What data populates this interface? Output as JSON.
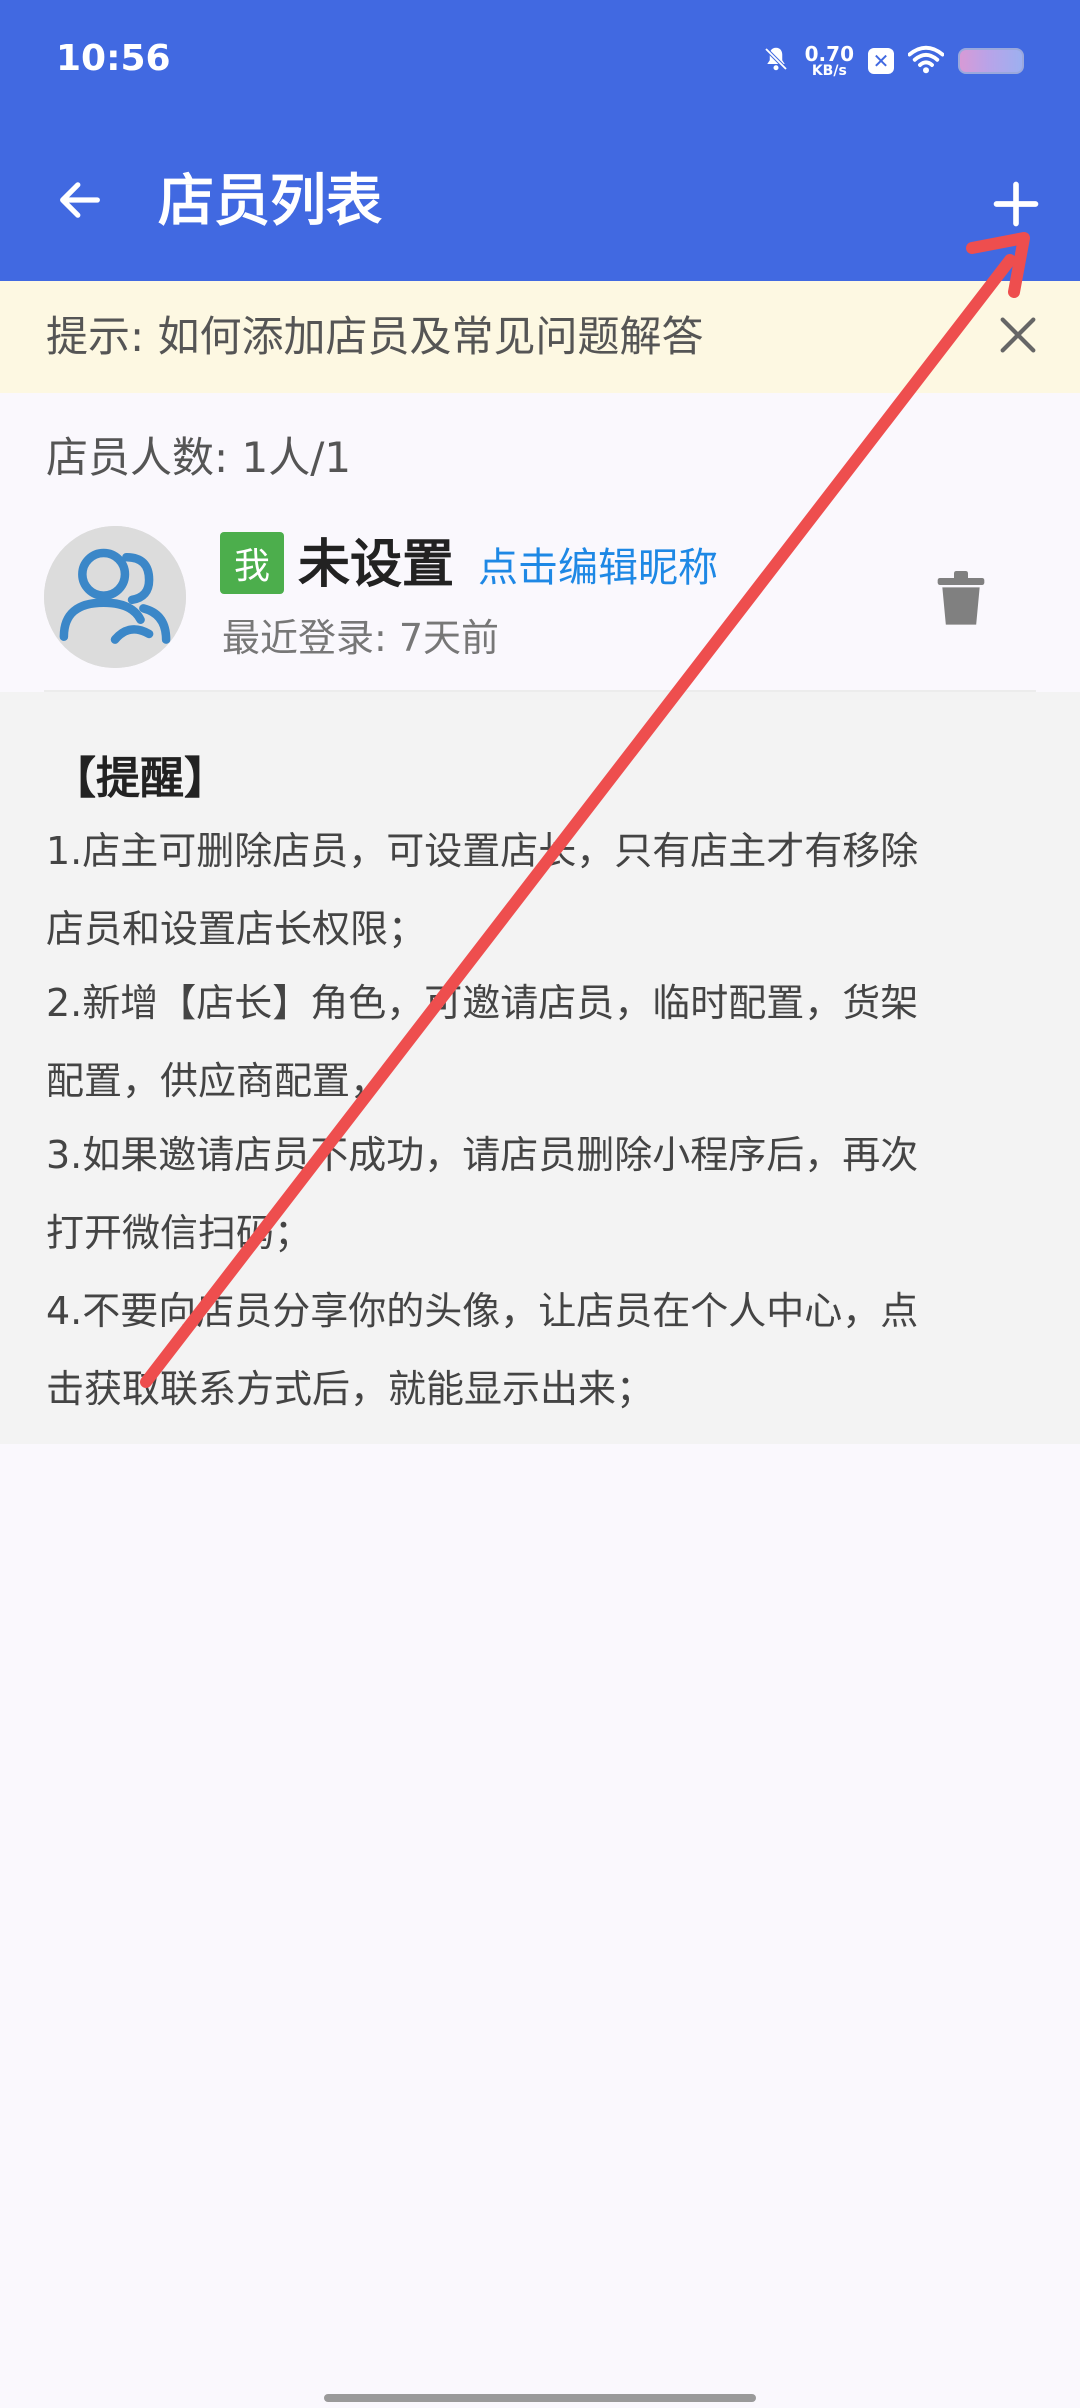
{
  "status_bar": {
    "time": "10:56",
    "net_speed_value": "0.70",
    "net_speed_unit": "KB/s",
    "icons": [
      "bell-off-icon",
      "x-badge-icon",
      "wifi-icon",
      "battery-icon"
    ]
  },
  "app_bar": {
    "title": "店员列表",
    "back_icon": "arrow-left-icon",
    "add_icon": "plus-icon",
    "color": "#4169e1"
  },
  "tip": {
    "text": "提示: 如何添加店员及常见问题解答",
    "close_icon": "close-icon",
    "background": "#fdf8e2"
  },
  "staff_count": "店员人数: 1人/1",
  "staff": [
    {
      "badge": "我",
      "name": "未设置",
      "edit_link": "点击编辑昵称",
      "last_login": "最近登录: 7天前",
      "avatar_icon": "user-group-avatar-icon",
      "delete_icon": "trash-icon"
    }
  ],
  "reminder": {
    "title": "【提醒】",
    "lines": [
      "1.店主可删除店员，可设置店长，只有店主才有移除",
      "店员和设置店长权限；",
      "2.新增【店长】角色，可邀请店员，临时配置，货架",
      "配置，供应商配置，",
      "3.如果邀请店员不成功，请店员删除小程序后，再次",
      "打开微信扫码；",
      " 4.不要向店员分享你的头像，让店员在个人中心，点",
      " 击获取联系方式后，就能显示出来；"
    ]
  },
  "colors": {
    "primary": "#4169e1",
    "badge_green": "#4cae4c",
    "link_blue": "#1e88e5",
    "annotation_arrow": "#ee4e4e"
  }
}
